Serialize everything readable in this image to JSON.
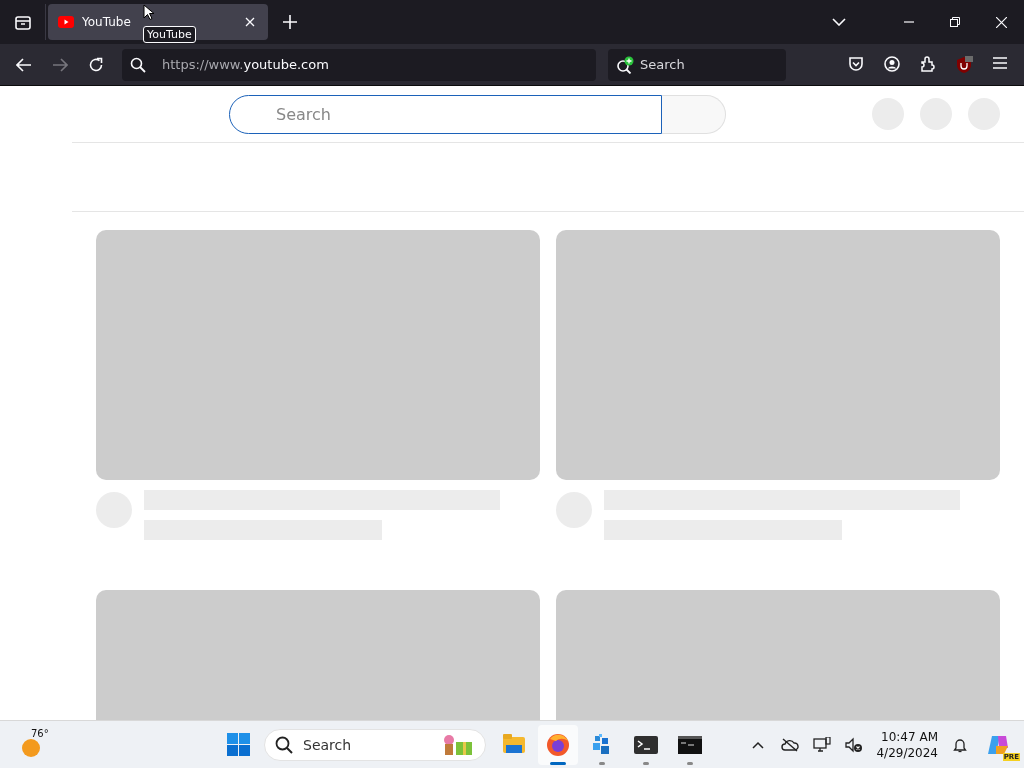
{
  "browser": {
    "tabs": [
      {
        "title": "YouTube",
        "selected": true
      }
    ],
    "tooltip": "YouTube",
    "address": {
      "scheme": "https://www.",
      "domain": "youtube.com"
    },
    "search_box": {
      "placeholder": "Search"
    }
  },
  "page": {
    "search": {
      "placeholder": "Search"
    },
    "videos": [
      {
        "kind": "full"
      },
      {
        "kind": "full"
      },
      {
        "kind": "thumbnail"
      },
      {
        "kind": "thumbnail"
      }
    ]
  },
  "taskbar": {
    "weather": "76°",
    "search": {
      "placeholder": "Search"
    },
    "apps": [
      {
        "kind": "files",
        "active": false,
        "running": false
      },
      {
        "kind": "firefox",
        "active": true,
        "running": true
      },
      {
        "kind": "blocks",
        "active": false,
        "running": true
      },
      {
        "kind": "terminal",
        "active": false,
        "running": true
      },
      {
        "kind": "console",
        "active": false,
        "running": true
      }
    ],
    "time": "10:47 AM",
    "date": "4/29/2024",
    "copilot_badge": "PRE"
  }
}
